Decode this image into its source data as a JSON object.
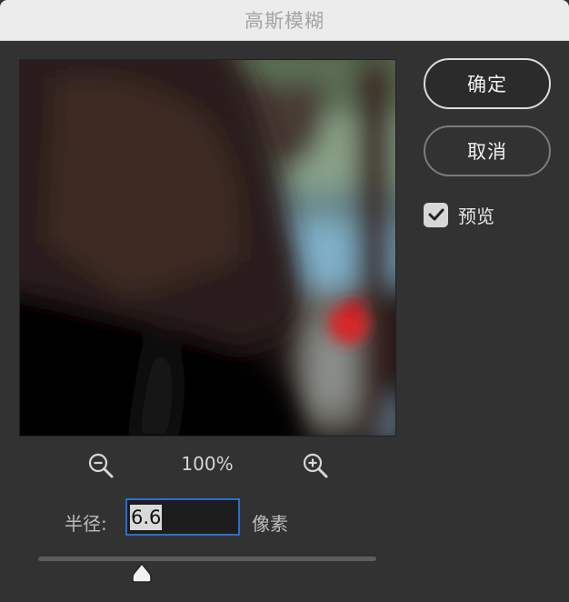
{
  "dialog": {
    "title": "高斯模糊"
  },
  "buttons": {
    "ok_label": "确定",
    "cancel_label": "取消"
  },
  "preview_toggle": {
    "label": "预览",
    "checked": true
  },
  "zoom": {
    "level": "100%",
    "out_icon": "zoom-out-icon",
    "in_icon": "zoom-in-icon"
  },
  "radius": {
    "label": "半径:",
    "value": "6.6",
    "unit": "像素"
  },
  "slider": {
    "min": 0.1,
    "max": 1000,
    "value": 6.6
  },
  "colors": {
    "accent": "#2a6fcf",
    "background": "#323232",
    "titlebar": "#ececec"
  }
}
